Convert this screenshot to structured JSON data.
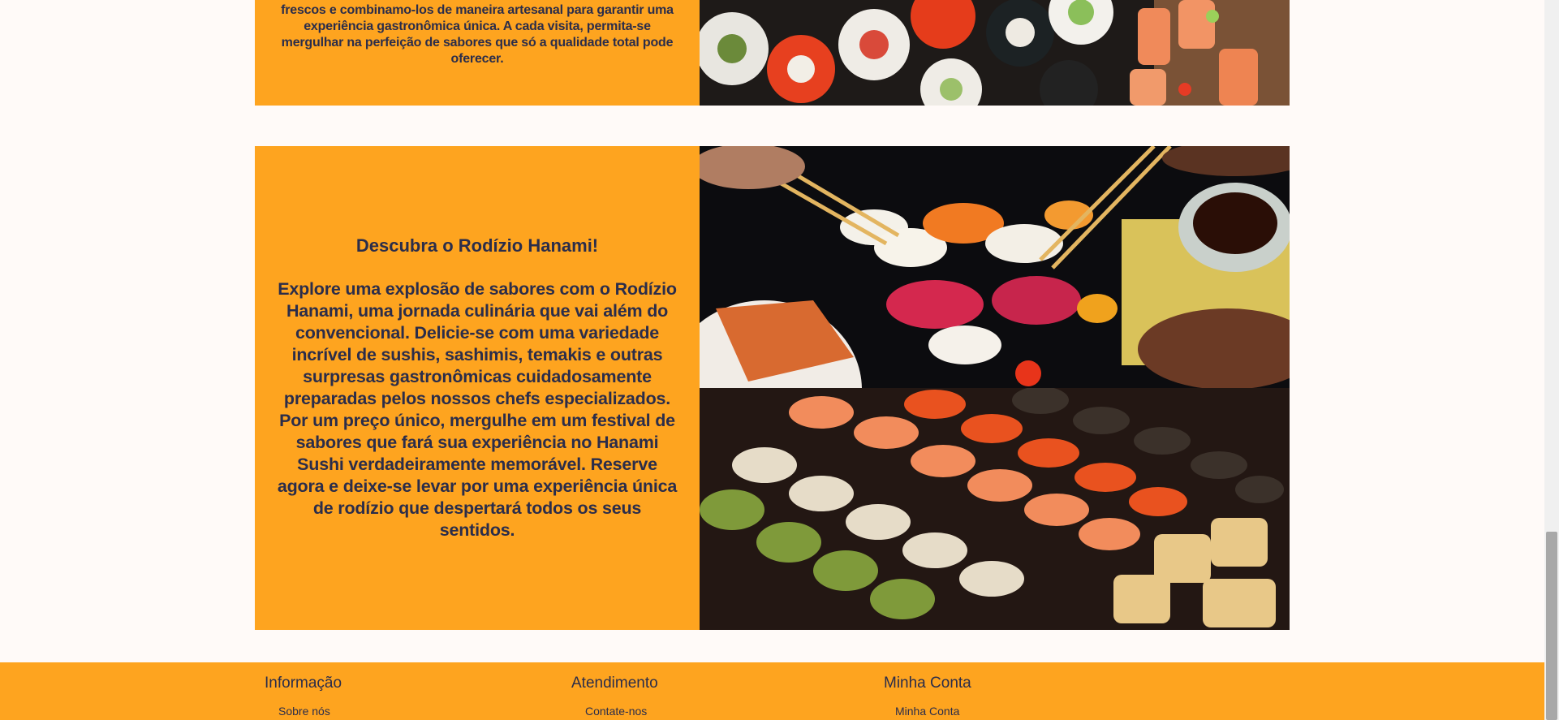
{
  "section_intro": {
    "text": "frescos e combinamo-los de maneira artesanal para garantir uma experiência gastronômica única. A cada visita, permita-se mergulhar na perfeição de sabores que só a qualidade total pode oferecer.",
    "image_alt": "sushi platter photo"
  },
  "section_rodizio": {
    "title": "Descubra o Rodízio Hanami!",
    "body": "Explore uma explosão de sabores com o Rodízio Hanami, uma jornada culinária que vai além do convencional. Delicie-se com uma variedade incrível de sushis, sashimis, temakis e outras surpresas gastronômicas cuidadosamente preparadas pelos nossos chefs especializados. Por um preço único, mergulhe em um festival de sabores que fará sua experiência no Hanami Sushi verdadeiramente memorável. Reserve agora e deixe-se levar por uma experiência única de rodízio que despertará todos os seus sentidos.",
    "image_top_alt": "nigiri with chopsticks photo",
    "image_bottom_alt": "sushi rolls rows photo"
  },
  "footer": {
    "columns": [
      {
        "heading": "Informação",
        "link": "Sobre nós"
      },
      {
        "heading": "Atendimento",
        "link": "Contate-nos"
      },
      {
        "heading": "Minha Conta",
        "link": "Minha Conta"
      }
    ]
  },
  "colors": {
    "accent": "#fea41f",
    "text": "#2b2d4a",
    "page_background": "#fffaf8"
  }
}
